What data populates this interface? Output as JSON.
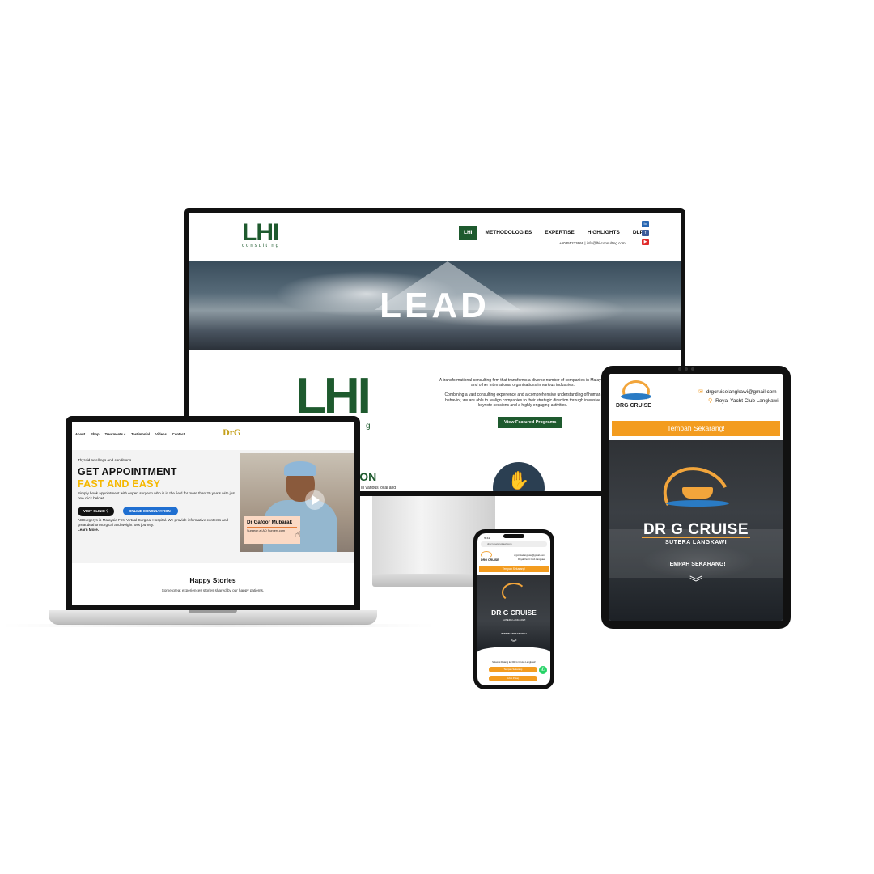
{
  "desktop": {
    "logo": {
      "mark": "LHI",
      "sub": "consulting"
    },
    "nav": [
      {
        "label": "LHI"
      },
      {
        "label": "METHODOLOGIES"
      },
      {
        "label": "EXPERTISE"
      },
      {
        "label": "HIGHLIGHTS"
      },
      {
        "label": "DLP"
      }
    ],
    "contact": "+60355233666 | info@lhi-consulting.com",
    "social": [
      "linkedin-icon",
      "facebook-icon",
      "youtube-icon"
    ],
    "hero_title": "LEAD",
    "big_logo": {
      "mark": "LHI",
      "sub": "g"
    },
    "about_p1": "A transformational consulting firm that transforms a diverse number of companies in Malaysia and other international organisations in various industries.",
    "about_p2": "Combining a vast consulting experience and a comprehensive understanding of human behavior, we are able to realign companies to their strategic direction through intensive keynote sessions and a highly engaging activities.",
    "cta": "View Featured Programs",
    "mission_heading": "SION",
    "mission_text": "partner in various local and",
    "colors": {
      "brand": "#1e5a2e"
    }
  },
  "laptop": {
    "nav": [
      "About",
      "Shop",
      "Treatments ▾",
      "Testimonial",
      "Videos",
      "Contact"
    ],
    "logo": "DrG",
    "eyebrow": "Thyroid swellings and conditions",
    "h1": "GET APPOINTMENT",
    "h2": "FAST AND EASY",
    "desc": "Simply book appointment with expert surgeon who is in the field for more than 20 years with just one click below!",
    "btn_visit": "VISIT CLINIC  ⚲",
    "btn_online": "ONLINE CONSULTATION  ›",
    "note": "ADSurgerys is Malaysia First Virtual Surgical Hospital. We provide informative contents and great deal on surgical and weight loss journey.",
    "learn_more": "Learn More.",
    "doctor_name": "Dr Gafoor Mubarak",
    "doctor_role": "Surgeon at AD Surgery.com",
    "stories_title": "Happy Stories",
    "stories_sub": "Some great experiences stories shared by our happy patients.",
    "colors": {
      "accent": "#f5b800",
      "button_blue": "#1f6fd1"
    }
  },
  "tablet": {
    "logo_text": "DRG CRUISE",
    "email": "drgcruiselangkawi@gmail.com",
    "location": "Royal Yacht Club Langkawi",
    "cta": "Tempah Sekarang!",
    "hero_arc_text": "SUTERA LANGKAWI",
    "hero_title": "DR G CRUISE",
    "hero_sub": "SUTERA LANGKAWI",
    "hero_tempah": "TEMPAH SEKARANG!",
    "chevron": "❯❯",
    "colors": {
      "orange": "#f39c1f",
      "sea": "#2a7bc4"
    }
  },
  "phone": {
    "time": "9:41",
    "url": "drgcruiselangkawi.com",
    "logo_text": "DRG CRUISE",
    "email": "drgcruiselangkawi@gmail.com",
    "location": "Royal Yacht Club Langkawi",
    "cta": "Tempah Sekarang!",
    "hero_title": "DR G CRUISE",
    "hero_sub": "SUTERA LANGKAWI",
    "hero_tempah": "TEMPAH SEKARANG!",
    "welcome": "Selamat Datang ke DR G Cruise Langkawi!",
    "btn1": "Tempah Sekarang",
    "btn2": "Lihat Pakej"
  }
}
